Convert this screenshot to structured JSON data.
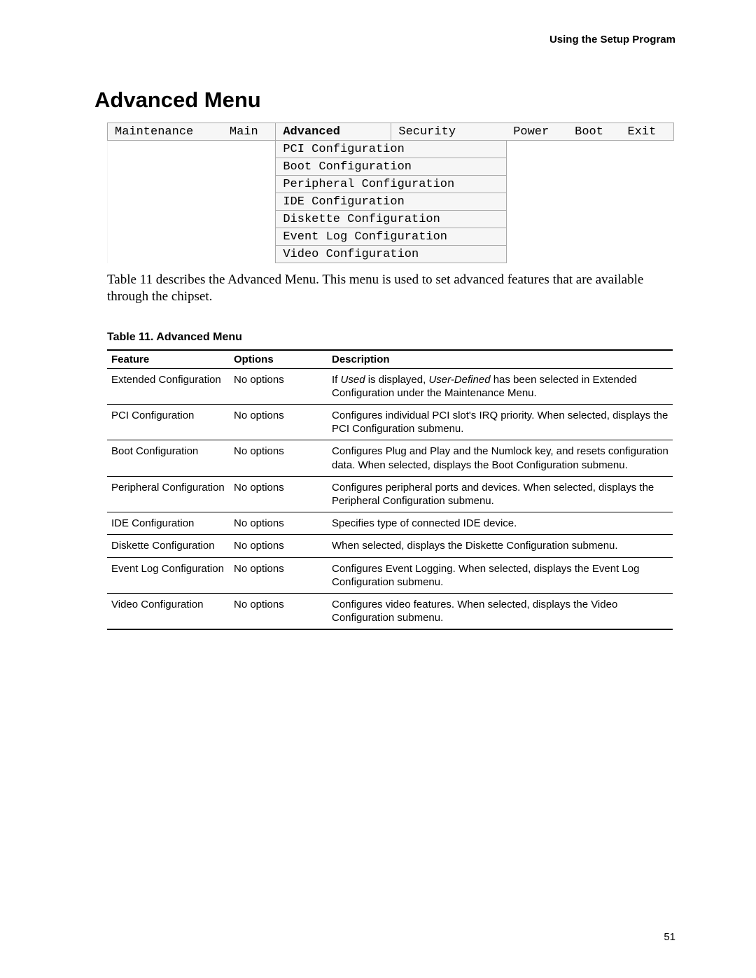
{
  "runningHead": "Using the Setup Program",
  "sectionTitle": "Advanced Menu",
  "biosTabs": {
    "maintenance": "Maintenance",
    "main": "Main",
    "advanced": "Advanced",
    "security": "Security",
    "power": "Power",
    "boot": "Boot",
    "exit": "Exit"
  },
  "biosSubmenu": [
    "PCI Configuration",
    "Boot Configuration",
    "Peripheral Configuration",
    "IDE Configuration",
    "Diskette Configuration",
    "Event Log Configuration",
    "Video Configuration"
  ],
  "bodyText": "Table 11 describes the Advanced Menu.  This menu is used to set advanced features that are available through the chipset.",
  "tableCaption": "Table 11.    Advanced Menu",
  "detailHeaders": {
    "feature": "Feature",
    "options": "Options",
    "description": "Description"
  },
  "detailRows": [
    {
      "feature": "Extended Configuration",
      "options": "No options",
      "descParts": [
        "If ",
        "Used",
        " is displayed, ",
        "User-Defined",
        " has been selected in Extended Configuration under the Maintenance Menu."
      ]
    },
    {
      "feature": "PCI Configuration",
      "options": "No options",
      "desc": "Configures individual PCI slot's IRQ priority.  When selected, displays the PCI Configuration submenu."
    },
    {
      "feature": "Boot Configuration",
      "options": "No options",
      "desc": "Configures Plug and Play and the Numlock key, and resets configuration data.  When selected, displays the Boot Configuration submenu."
    },
    {
      "feature": "Peripheral Configuration",
      "options": "No options",
      "desc": "Configures peripheral ports and devices.  When selected, displays the Peripheral Configuration submenu."
    },
    {
      "feature": "IDE Configuration",
      "options": "No options",
      "desc": "Specifies type of connected IDE device."
    },
    {
      "feature": "Diskette Configuration",
      "options": "No options",
      "desc": "When selected, displays the Diskette Configuration submenu."
    },
    {
      "feature": "Event Log Configuration",
      "options": "No options",
      "desc": "Configures Event Logging.  When selected, displays the Event Log Configuration submenu."
    },
    {
      "feature": "Video Configuration",
      "options": "No options",
      "desc": "Configures video features.  When selected, displays the Video Configuration submenu."
    }
  ],
  "pageNumber": "51"
}
